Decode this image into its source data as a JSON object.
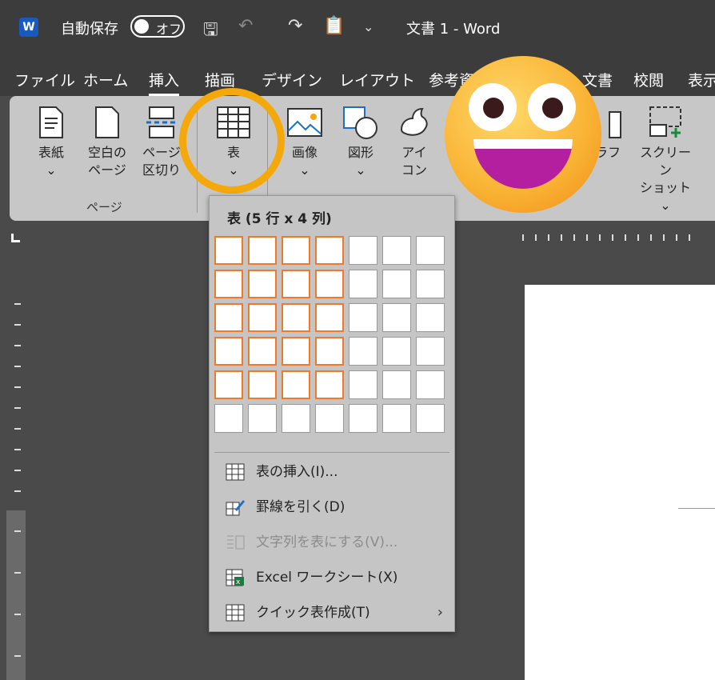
{
  "titlebar": {
    "autosave_label": "自動保存",
    "toggle_label": "オフ",
    "doc_title": "文書 1 - Word"
  },
  "tabs": [
    "ファイル",
    "ホーム",
    "挿入",
    "描画",
    "デザイン",
    "レイアウト",
    "参考資",
    "文書",
    "校閲",
    "表示"
  ],
  "ribbon": {
    "cover": [
      "表紙"
    ],
    "blank": [
      "空白の",
      "ページ"
    ],
    "break": [
      "ページ",
      "区切り"
    ],
    "table": "表",
    "image": "画像",
    "shape": "図形",
    "icon": [
      "アイ",
      "コン"
    ],
    "graph": "ラフ",
    "screenshot": [
      "スクリーン",
      "ショット"
    ],
    "group_pages": "ページ"
  },
  "dropdown": {
    "title": "表 (5 行 x 4 列)",
    "items": [
      {
        "label": "表の挿入(I)..."
      },
      {
        "label": "罫線を引く(D)"
      },
      {
        "label": "文字列を表にする(V)..."
      },
      {
        "label": "Excel ワークシート(X)"
      },
      {
        "label": "クイック表作成(T)"
      }
    ],
    "grid": {
      "rows_selected": 5,
      "cols_selected": 4,
      "rows_total": 6,
      "cols_total": 7
    },
    "accent": "#f07a2a"
  },
  "highlight_color": "#f4a80a"
}
